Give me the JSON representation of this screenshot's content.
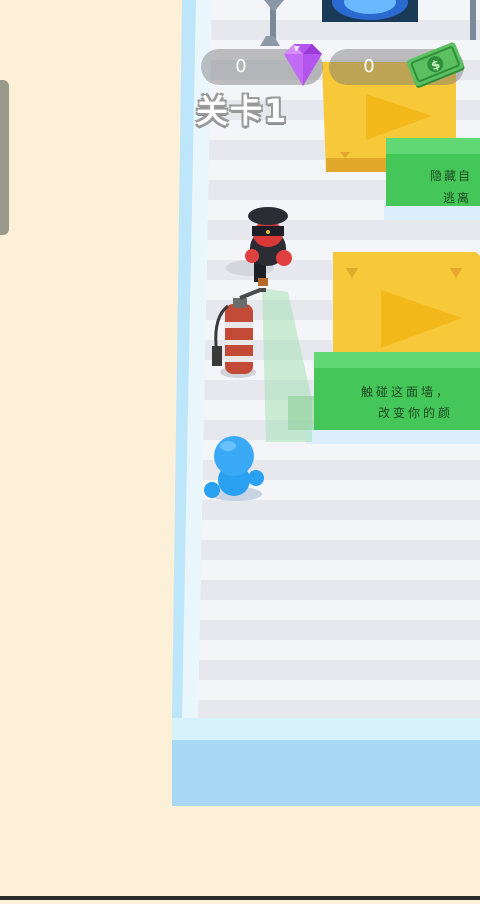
{
  "hud": {
    "gems": "0",
    "cash": "0",
    "level_label": "关卡1"
  },
  "signs": {
    "upper_line1": "隐藏自",
    "upper_line2": "逃离",
    "lower_line1": "触碰这面墙，",
    "lower_line2": "改变你的颜"
  },
  "colors": {
    "background": "#fdf0d8",
    "floor_stripe_light": "#f4f5f8",
    "floor_stripe_dark": "#e4e6ec",
    "wall": "#a8d8f4",
    "sign_green": "#44c659",
    "pad_yellow": "#f6c83a",
    "player_blue": "#2aa0f0",
    "guard_dark": "#2c2c34",
    "extinguisher": "#d0523e",
    "gem_purple": "#b455f0",
    "cash_green": "#4caf50"
  },
  "icons": [
    "gem-icon",
    "cash-icon",
    "play-arrow-icon",
    "portal-icon",
    "palm-tree-icon"
  ]
}
